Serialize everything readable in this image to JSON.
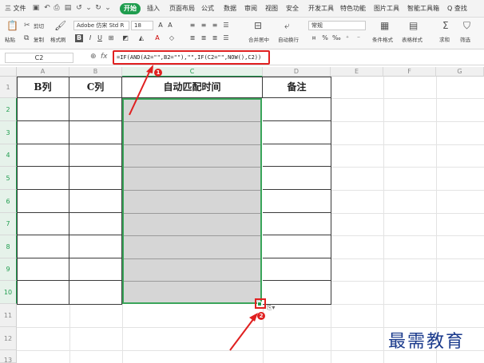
{
  "menubar": {
    "file": "三 文件",
    "tabs": [
      "开始",
      "插入",
      "页面布局",
      "公式",
      "数据",
      "审阅",
      "视图",
      "安全",
      "开发工具",
      "特色功能",
      "图片工具",
      "智能工具箱"
    ],
    "search": "Q 查找"
  },
  "ribbon": {
    "paste": "粘贴",
    "cut": "剪切",
    "copy": "复制",
    "format_painter": "格式刷",
    "font_name": "Adobe 仿宋 Std R",
    "font_size": "18",
    "merge_center": "合并居中",
    "wrap_text": "自动换行",
    "number_format": "常规",
    "conditional_format": "条件格式",
    "table_style": "表格样式",
    "sum": "求和",
    "filter": "筛选"
  },
  "formula_bar": {
    "name_box": "C2",
    "fx": "fx",
    "formula": "=IF(AND(A2=\"\",B2=\"\"),\"\",IF(C2=\"\",NOW(),C2))"
  },
  "columns": [
    "A",
    "B",
    "C",
    "D",
    "E",
    "F",
    "G"
  ],
  "rows": [
    "1",
    "2",
    "3",
    "4",
    "5",
    "6",
    "7",
    "8",
    "9",
    "10",
    "11",
    "12",
    "13"
  ],
  "headers": {
    "b_col": "B列",
    "c_col": "C列",
    "auto_time": "自动匹配时间",
    "remark": "备注"
  },
  "annotations": {
    "badge1": "1",
    "badge2": "2"
  },
  "watermark": "最需教育",
  "colors": {
    "accent_green": "#1f9d4e",
    "annotation_red": "#e02020",
    "selection_fill": "#d6d6d6"
  }
}
